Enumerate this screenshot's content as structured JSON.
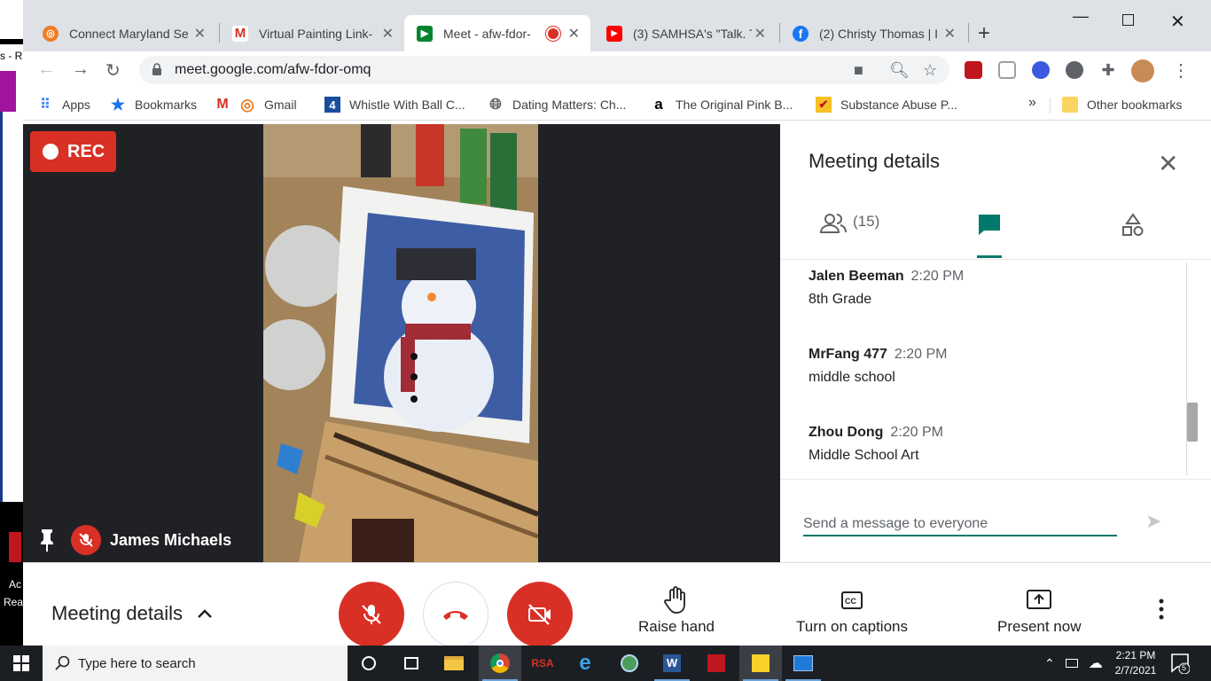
{
  "browser": {
    "tabs": [
      {
        "title": "Connect Maryland Se",
        "active": false
      },
      {
        "title": "Virtual Painting Link-",
        "active": false
      },
      {
        "title": "Meet - afw-fdor-",
        "active": true
      },
      {
        "title": "(3) SAMHSA's \"Talk. T",
        "active": false
      },
      {
        "title": "(2) Christy Thomas | I",
        "active": false
      }
    ],
    "url": "meet.google.com/afw-fdor-omq",
    "bookmarks": [
      "Apps",
      "Bookmarks",
      "Gmail",
      "Whistle With Ball C...",
      "Dating Matters: Ch...",
      "The Original Pink B...",
      "Substance Abuse P...",
      "»",
      "Other bookmarks"
    ]
  },
  "meet": {
    "rec_label": "REC",
    "presenter_name": "James Michaels",
    "panel": {
      "title": "Meeting details",
      "people_count": "(15)",
      "messages": [
        {
          "sender": "Jalen Beeman",
          "time": "2:20 PM",
          "text": "8th Grade"
        },
        {
          "sender": "MrFang 477",
          "time": "2:20 PM",
          "text": "middle school"
        },
        {
          "sender": "Zhou Dong",
          "time": "2:20 PM",
          "text": "Middle School Art"
        }
      ],
      "input_placeholder": "Send a message to everyone"
    },
    "bottom": {
      "details_label": "Meeting details",
      "raise_hand": "Raise hand",
      "captions": "Turn on captions",
      "present": "Present now"
    }
  },
  "taskbar": {
    "search_placeholder": "Type here to search",
    "time": "2:21 PM",
    "date": "2/7/2021",
    "notifications": "5"
  },
  "colors": {
    "meet_red": "#d93025",
    "meet_teal": "#00796b",
    "stage_bg": "#202124"
  }
}
